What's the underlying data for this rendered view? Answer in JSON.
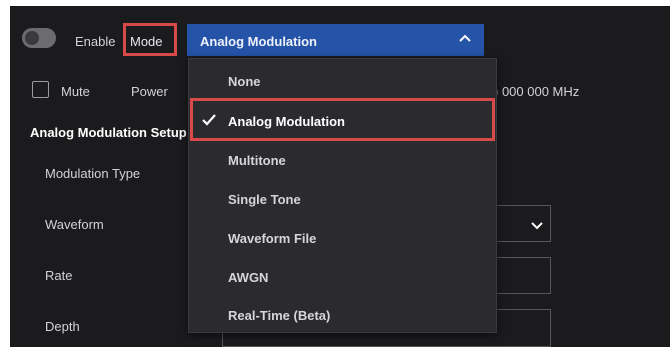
{
  "header": {
    "enable_label": "Enable",
    "mode_label": "Mode",
    "mode_value": "Analog Modulation",
    "mute_label": "Mute",
    "power_label": "Power",
    "frequency_partial": ") 000 000 MHz"
  },
  "section": {
    "title": "Analog Modulation Setup"
  },
  "fields": {
    "modulation_type": "Modulation Type",
    "waveform": "Waveform",
    "rate": "Rate",
    "depth": "Depth"
  },
  "dropdown": {
    "options": [
      {
        "label": "None",
        "selected": false
      },
      {
        "label": "Analog Modulation",
        "selected": true
      },
      {
        "label": "Multitone",
        "selected": false
      },
      {
        "label": "Single Tone",
        "selected": false
      },
      {
        "label": "Waveform File",
        "selected": false
      },
      {
        "label": "AWGN",
        "selected": false
      },
      {
        "label": "Real-Time (Beta)",
        "selected": false
      }
    ]
  },
  "colors": {
    "panel_bg": "#1b1b1d",
    "select_blue": "#2453a8",
    "highlight_red": "#d84a4a",
    "dropdown_bg": "#2b2b2f"
  },
  "icons": {
    "toggle": "toggle-switch-icon",
    "checkbox": "checkbox-icon",
    "chevron_up": "chevron-up-icon",
    "chevron_down": "chevron-down-icon",
    "check": "check-icon"
  }
}
